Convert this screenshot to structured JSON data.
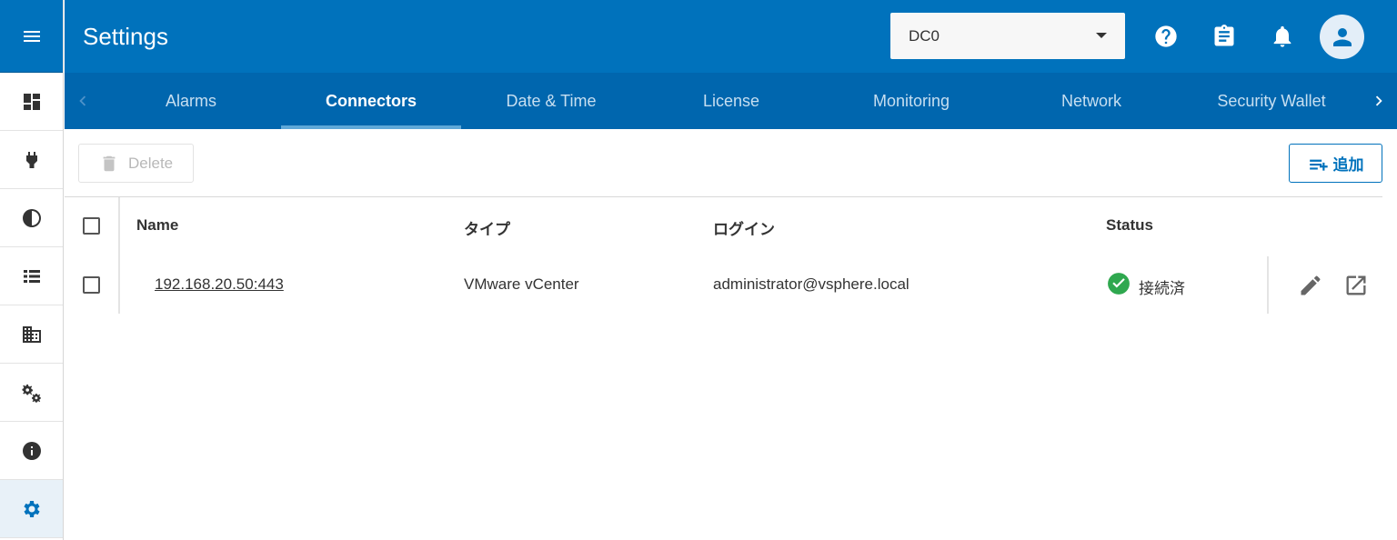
{
  "header": {
    "title": "Settings",
    "datacenter_value": "DC0"
  },
  "rail": {
    "items": [
      "dashboard-icon",
      "plug-icon",
      "contrast-icon",
      "list-icon",
      "building-icon",
      "gears-icon",
      "info-icon",
      "settings-gear-icon"
    ],
    "active": "settings-gear-icon"
  },
  "tabs": {
    "items": [
      "Alarms",
      "Connectors",
      "Date & Time",
      "License",
      "Monitoring",
      "Network",
      "Security Wallet"
    ],
    "active": "Connectors"
  },
  "toolbar": {
    "delete_label": "Delete",
    "add_label": "追加"
  },
  "table": {
    "headers": {
      "name": "Name",
      "type": "タイプ",
      "login": "ログイン",
      "status": "Status"
    },
    "rows": [
      {
        "name": "192.168.20.50:443",
        "type": "VMware vCenter",
        "login": "administrator@vsphere.local",
        "status": "接続済"
      }
    ]
  },
  "colors": {
    "header_blue": "#0072bc",
    "tab_bar_blue": "#0066ae",
    "status_green": "#2fa84f"
  }
}
